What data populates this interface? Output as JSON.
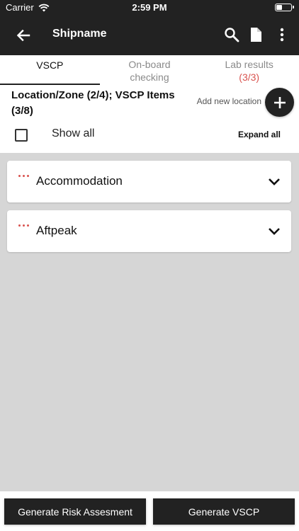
{
  "status_bar": {
    "carrier": "Carrier",
    "time": "2:59 PM",
    "battery_level": 0.4
  },
  "header": {
    "title": "Shipname",
    "back_icon": "arrow-left-icon",
    "search_icon": "search-icon",
    "document_icon": "document-icon",
    "more_icon": "more-vertical-icon"
  },
  "tabs": [
    {
      "label": "VSCP",
      "count": "",
      "active": true
    },
    {
      "label": "On-board checking",
      "count": "",
      "active": false
    },
    {
      "label": "Lab results",
      "count": "(3/3)",
      "active": false
    }
  ],
  "panel": {
    "title": "Location/Zone (2/4); VSCP Items (3/8)",
    "add_location_label": "Add new location",
    "show_all_label": "Show all",
    "show_all_checked": false,
    "expand_all_label": "Expand all"
  },
  "locations": [
    {
      "name": "Accommodation"
    },
    {
      "name": "Aftpeak"
    }
  ],
  "footer": {
    "risk_button": "Generate Risk Assesment",
    "vscp_button": "Generate VSCP"
  },
  "colors": {
    "dark": "#222222",
    "accent_red": "#d9534f",
    "background": "#d6d6d6"
  }
}
